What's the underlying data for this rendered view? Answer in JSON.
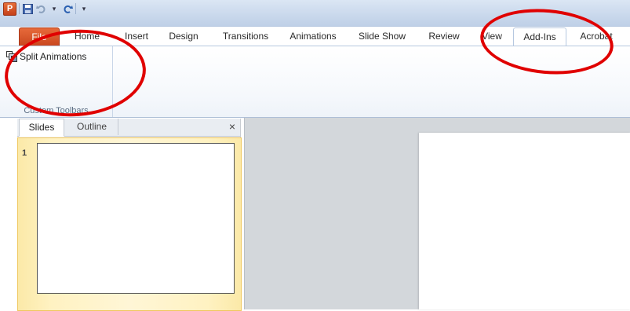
{
  "quick_access": {
    "app_icon_letter": "P"
  },
  "tabs": [
    {
      "label": "File"
    },
    {
      "label": "Home"
    },
    {
      "label": "Insert"
    },
    {
      "label": "Design"
    },
    {
      "label": "Transitions"
    },
    {
      "label": "Animations"
    },
    {
      "label": "Slide Show"
    },
    {
      "label": "Review"
    },
    {
      "label": "View"
    },
    {
      "label": "Add-Ins"
    },
    {
      "label": "Acrobat"
    }
  ],
  "active_tab": "Add-Ins",
  "ribbon": {
    "split_animations_label": "Split Animations",
    "group_label": "Custom Toolbars"
  },
  "pane": {
    "tab_slides": "Slides",
    "tab_outline": "Outline",
    "close_symbol": "×",
    "slide_number": "1"
  },
  "colors": {
    "annotation": "#e00000",
    "file_tab": "#d35224"
  }
}
